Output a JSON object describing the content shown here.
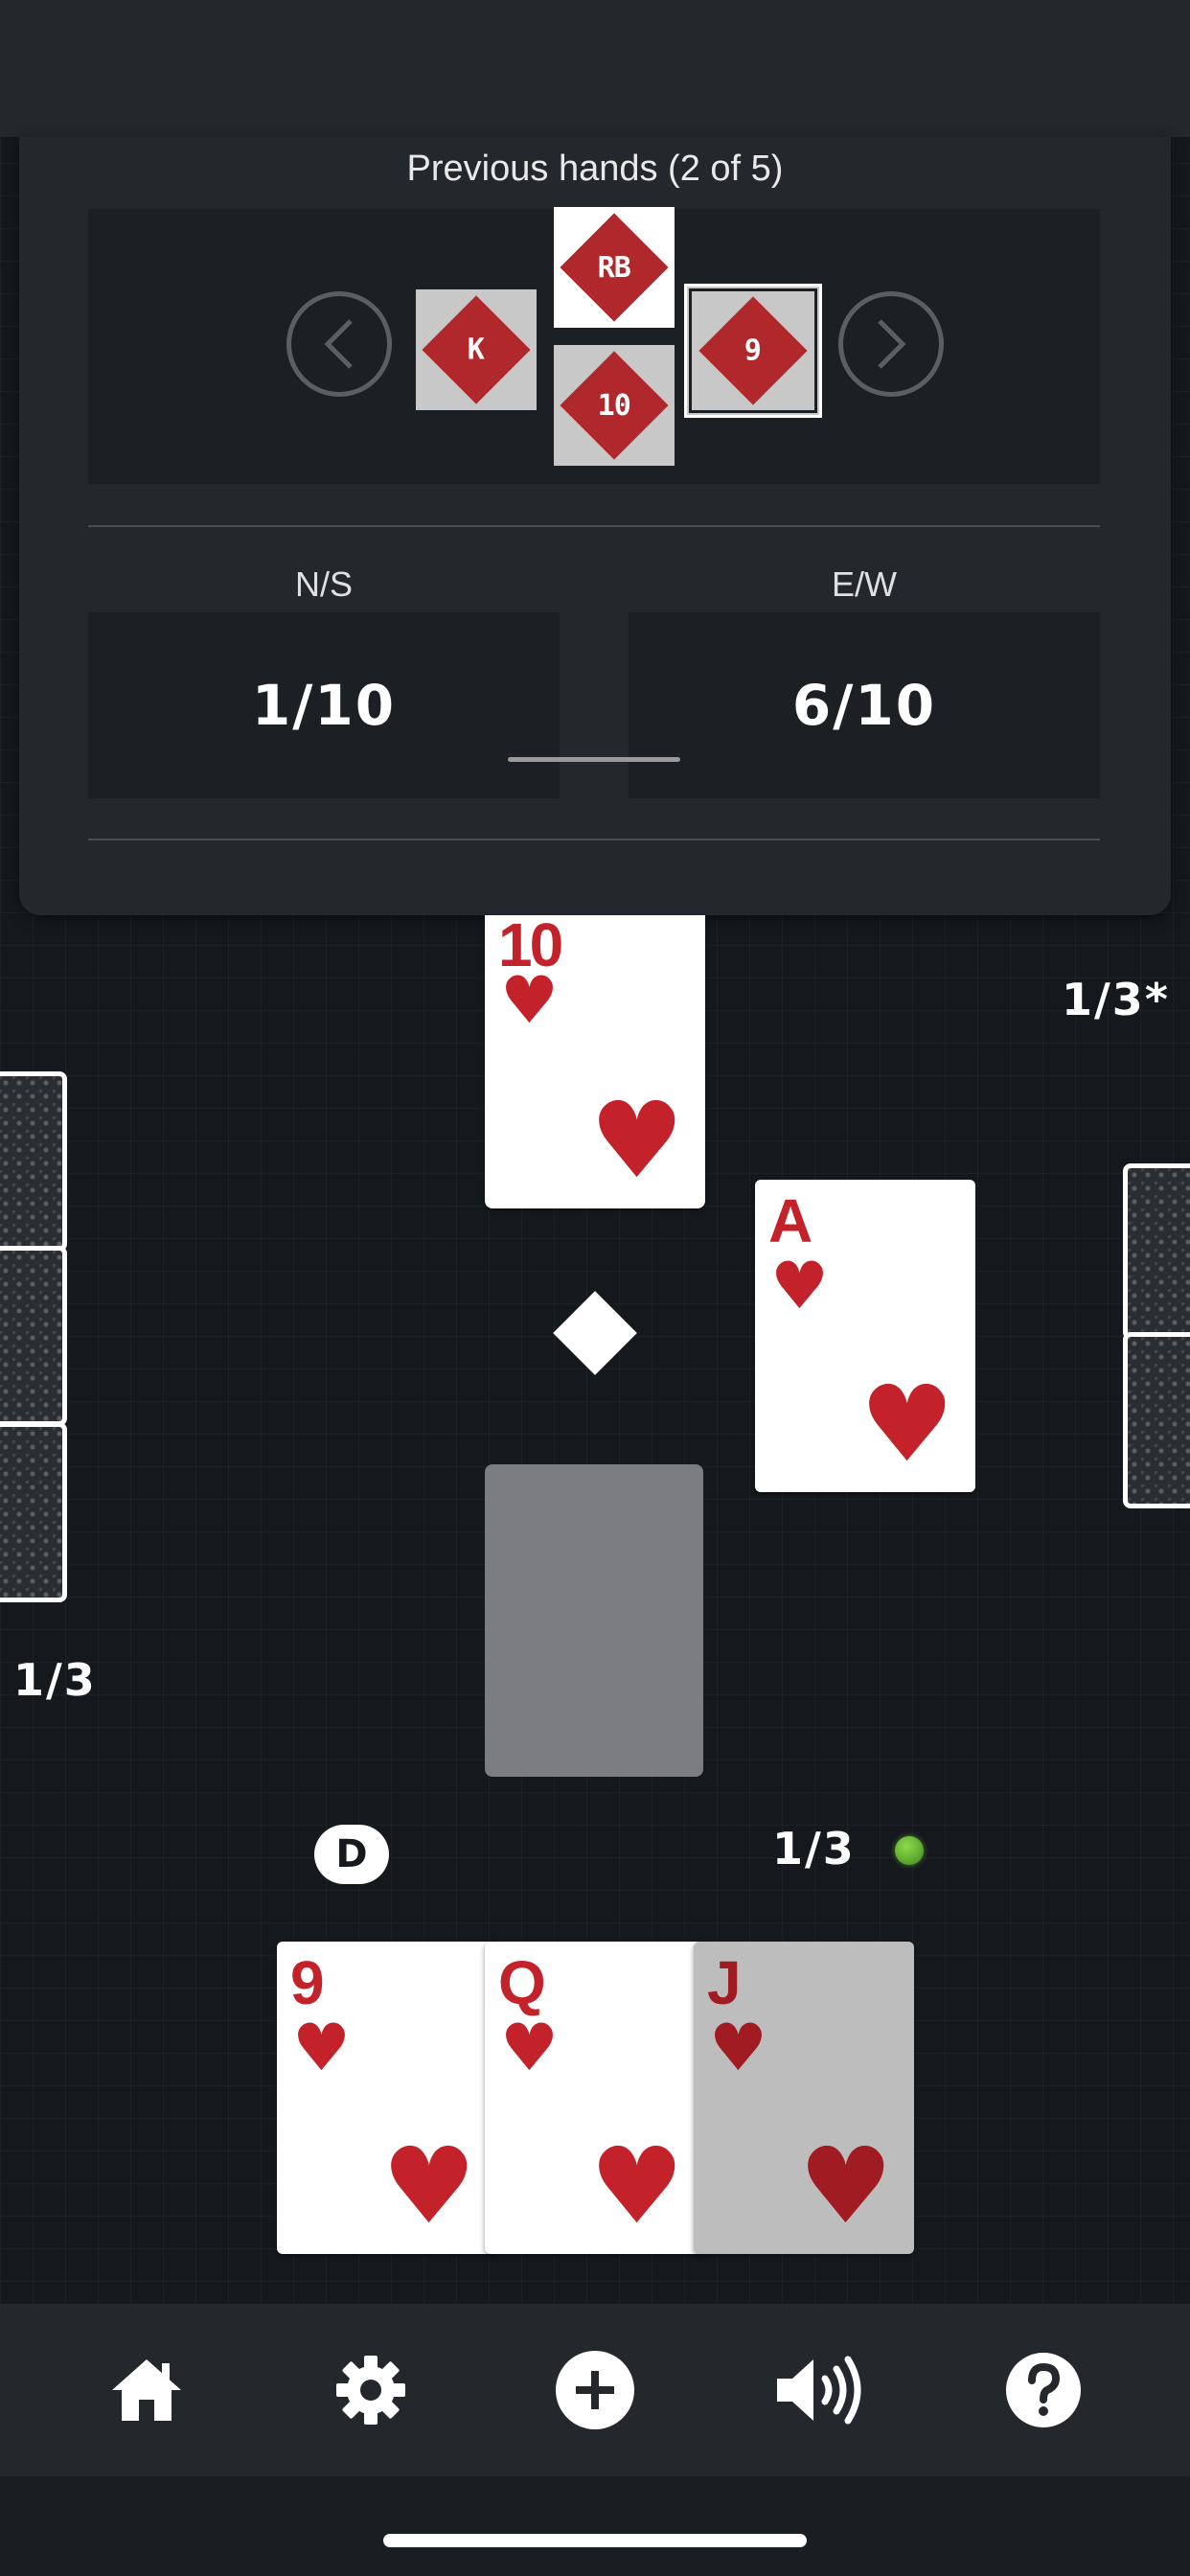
{
  "previous_hands": {
    "title": "Previous hands (2 of 5)",
    "trick_cards": [
      {
        "seat": "west",
        "label": "K"
      },
      {
        "seat": "north",
        "label": "RB"
      },
      {
        "seat": "south",
        "label": "10"
      },
      {
        "seat": "east",
        "label": "9"
      }
    ],
    "scores": [
      {
        "team": "N/S",
        "value": "1/10"
      },
      {
        "team": "E/W",
        "value": "6/10"
      }
    ]
  },
  "table": {
    "north_card": {
      "rank": "10",
      "suit": "♥"
    },
    "east_card": {
      "rank": "A",
      "suit": "♥"
    },
    "my_hand": [
      {
        "rank": "9",
        "suit": "♥"
      },
      {
        "rank": "Q",
        "suit": "♥"
      },
      {
        "rank": "J",
        "suit": "♥"
      }
    ],
    "counts": {
      "east": "1/3*",
      "west": "1/3",
      "south": "1/3"
    },
    "dealer_badge": "D"
  },
  "toolbar": {
    "buttons": [
      "home-icon",
      "gear-icon",
      "plus-icon",
      "speaker-icon",
      "help-icon"
    ]
  },
  "colors": {
    "card_red": "#c4222b",
    "panel": "#24282d",
    "table": "#15191e"
  }
}
